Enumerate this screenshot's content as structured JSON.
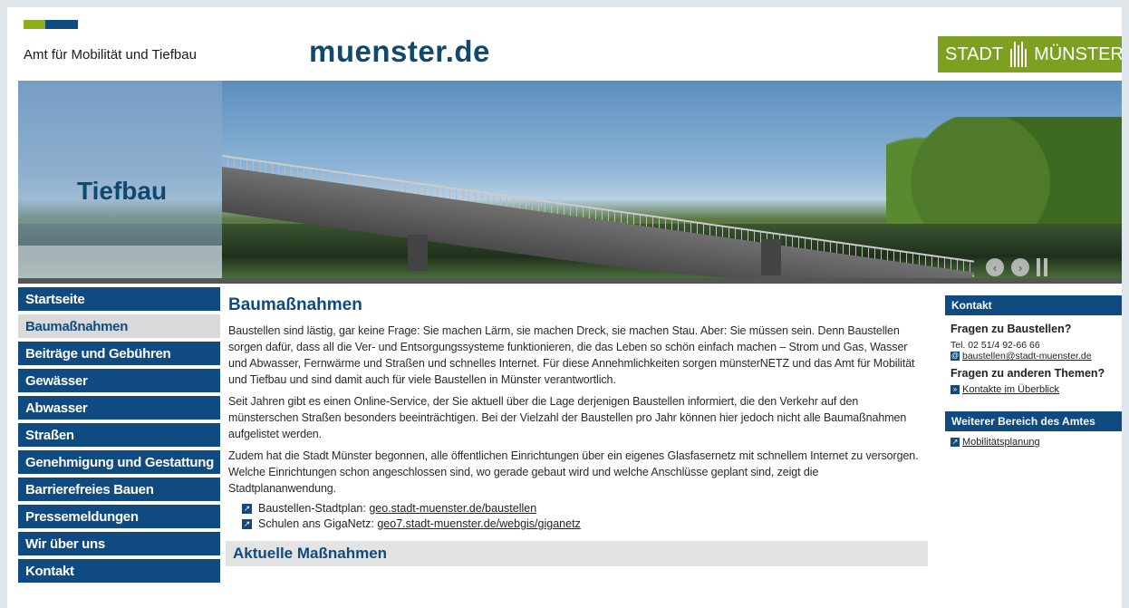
{
  "header": {
    "department": "Amt für Mobilität und Tiefbau",
    "site_name": "muenster.de",
    "city_logo_left": "STADT",
    "city_logo_right": "MÜNSTER",
    "logo_colors": [
      "#8fae1b",
      "#0f4a80"
    ]
  },
  "banner": {
    "title": "Tiefbau",
    "prev_icon": "chevron-left-icon",
    "next_icon": "chevron-right-icon",
    "pause_icon": "pause-icon"
  },
  "nav": {
    "items": [
      {
        "label": "Startseite"
      },
      {
        "label": "Baumaßnahmen",
        "active": true
      },
      {
        "label": "Beiträge und Gebühren"
      },
      {
        "label": "Gewässer"
      },
      {
        "label": "Abwasser"
      },
      {
        "label": "Straßen"
      },
      {
        "label": "Genehmigung und Gestattung"
      },
      {
        "label": "Barrierefreies Bauen"
      },
      {
        "label": "Pressemeldungen"
      },
      {
        "label": "Wir über uns"
      },
      {
        "label": "Kontakt"
      }
    ]
  },
  "main": {
    "title": "Baumaßnahmen",
    "paragraphs": [
      "Baustellen sind lästig, gar keine Frage: Sie machen Lärm, sie machen Dreck, sie machen Stau. Aber: Sie müssen sein. Denn Baustellen sorgen dafür, dass all die Ver- und Entsorgungssysteme funktionieren, die das Leben so schön einfach machen – Strom und Gas, Wasser und Abwasser, Fernwärme und Straßen und schnelles Internet. Für diese Annehmlichkeiten sorgen münsterNETZ und das Amt für Mobilität und Tiefbau und sind damit auch für viele Baustellen in Münster verantwortlich.",
      "Seit Jahren gibt es einen Online-Service, der Sie aktuell über die Lage derjenigen Baustellen informiert, die den Verkehr auf den münsterschen Straßen besonders beeinträchtigen. Bei der Vielzahl der Baustellen pro Jahr können hier jedoch nicht alle Baumaßnahmen aufgelistet werden.",
      "Zudem hat die Stadt Münster begonnen, alle öffentlichen Einrichtungen über ein eigenes Glasfasernetz mit schnellem Internet zu versorgen. Welche Einrichtungen schon angeschlossen sind, wo gerade gebaut wird und welche Anschlüsse geplant sind, zeigt die Stadtplananwendung."
    ],
    "links": [
      {
        "prefix": "Baustellen-Stadtplan: ",
        "text": "geo.stadt-muenster.de/baustellen"
      },
      {
        "prefix": "Schulen ans GigaNetz: ",
        "text": "geo7.stadt-muenster.de/webgis/giganetz"
      }
    ],
    "section_title": "Aktuelle Maßnahmen"
  },
  "sidebar": {
    "contact_title": "Kontakt",
    "q1": "Fragen zu Baustellen?",
    "tel": "Tel. 02 51/4 92-66 66",
    "email": "baustellen@stadt-muenster.de",
    "q2": "Fragen zu anderen Themen?",
    "contacts_link": "Kontakte im Überblick",
    "more_title": "Weiterer Bereich des Amtes",
    "more_link": "Mobilitätsplanung"
  }
}
